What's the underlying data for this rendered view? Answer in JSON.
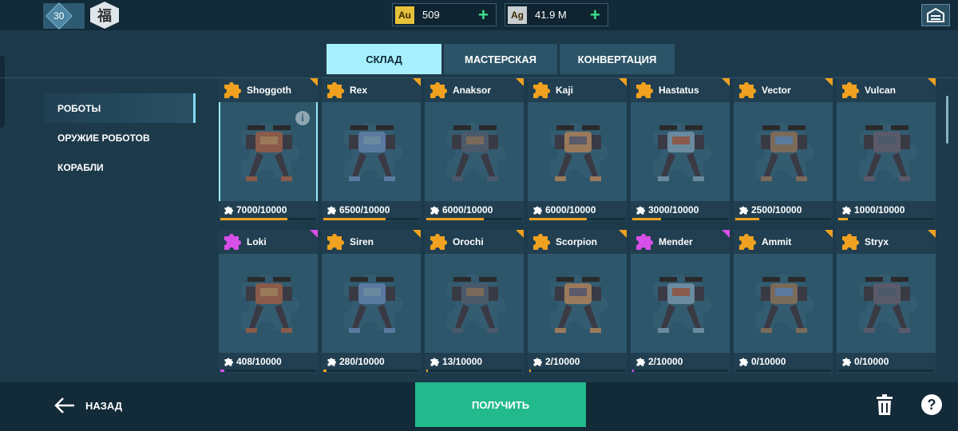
{
  "topbar": {
    "level": "30",
    "league_emblem": "福",
    "gold": {
      "tag": "Au",
      "amount": "509",
      "color": "#e6c13a"
    },
    "silver": {
      "tag": "Ag",
      "amount": "41.9 M",
      "color": "#c9ced2"
    }
  },
  "tabs": [
    {
      "label": "СКЛАД",
      "active": true
    },
    {
      "label": "МАСТЕРСКАЯ",
      "active": false
    },
    {
      "label": "КОНВЕРТАЦИЯ",
      "active": false
    }
  ],
  "sidebar": {
    "items": [
      {
        "label": "РОБОТЫ",
        "active": true
      },
      {
        "label": "ОРУЖИЕ РОБОТОВ",
        "active": false
      },
      {
        "label": "КОРАБЛИ",
        "active": false
      }
    ]
  },
  "cards": [
    {
      "name": "Shoggoth",
      "count": "7000/10000",
      "progress": 0.7,
      "rarity": "legendary",
      "selected": true,
      "info": "i"
    },
    {
      "name": "Rex",
      "count": "6500/10000",
      "progress": 0.65,
      "rarity": "legendary"
    },
    {
      "name": "Anaksor",
      "count": "6000/10000",
      "progress": 0.6,
      "rarity": "legendary"
    },
    {
      "name": "Kaji",
      "count": "6000/10000",
      "progress": 0.6,
      "rarity": "legendary"
    },
    {
      "name": "Hastatus",
      "count": "3000/10000",
      "progress": 0.3,
      "rarity": "legendary"
    },
    {
      "name": "Vector",
      "count": "2500/10000",
      "progress": 0.25,
      "rarity": "legendary"
    },
    {
      "name": "Vulcan",
      "count": "1000/10000",
      "progress": 0.1,
      "rarity": "legendary"
    },
    {
      "name": "Loki",
      "count": "408/10000",
      "progress": 0.04,
      "rarity": "epic"
    },
    {
      "name": "Siren",
      "count": "280/10000",
      "progress": 0.03,
      "rarity": "legendary"
    },
    {
      "name": "Orochi",
      "count": "13/10000",
      "progress": 0.01,
      "rarity": "legendary"
    },
    {
      "name": "Scorpion",
      "count": "2/10000",
      "progress": 0.01,
      "rarity": "legendary"
    },
    {
      "name": "Mender",
      "count": "2/10000",
      "progress": 0.01,
      "rarity": "epic"
    },
    {
      "name": "Ammit",
      "count": "0/10000",
      "progress": 0.0,
      "rarity": "legendary"
    },
    {
      "name": "Stryx",
      "count": "0/10000",
      "progress": 0.0,
      "rarity": "legendary"
    }
  ],
  "colors": {
    "legendary": "#f0a11f",
    "epic": "#d84ee8",
    "accent_button": "#22b98c"
  },
  "bottom": {
    "back_label": "НАЗАД",
    "get_label": "ПОЛУЧИТЬ",
    "help_label": "?"
  }
}
